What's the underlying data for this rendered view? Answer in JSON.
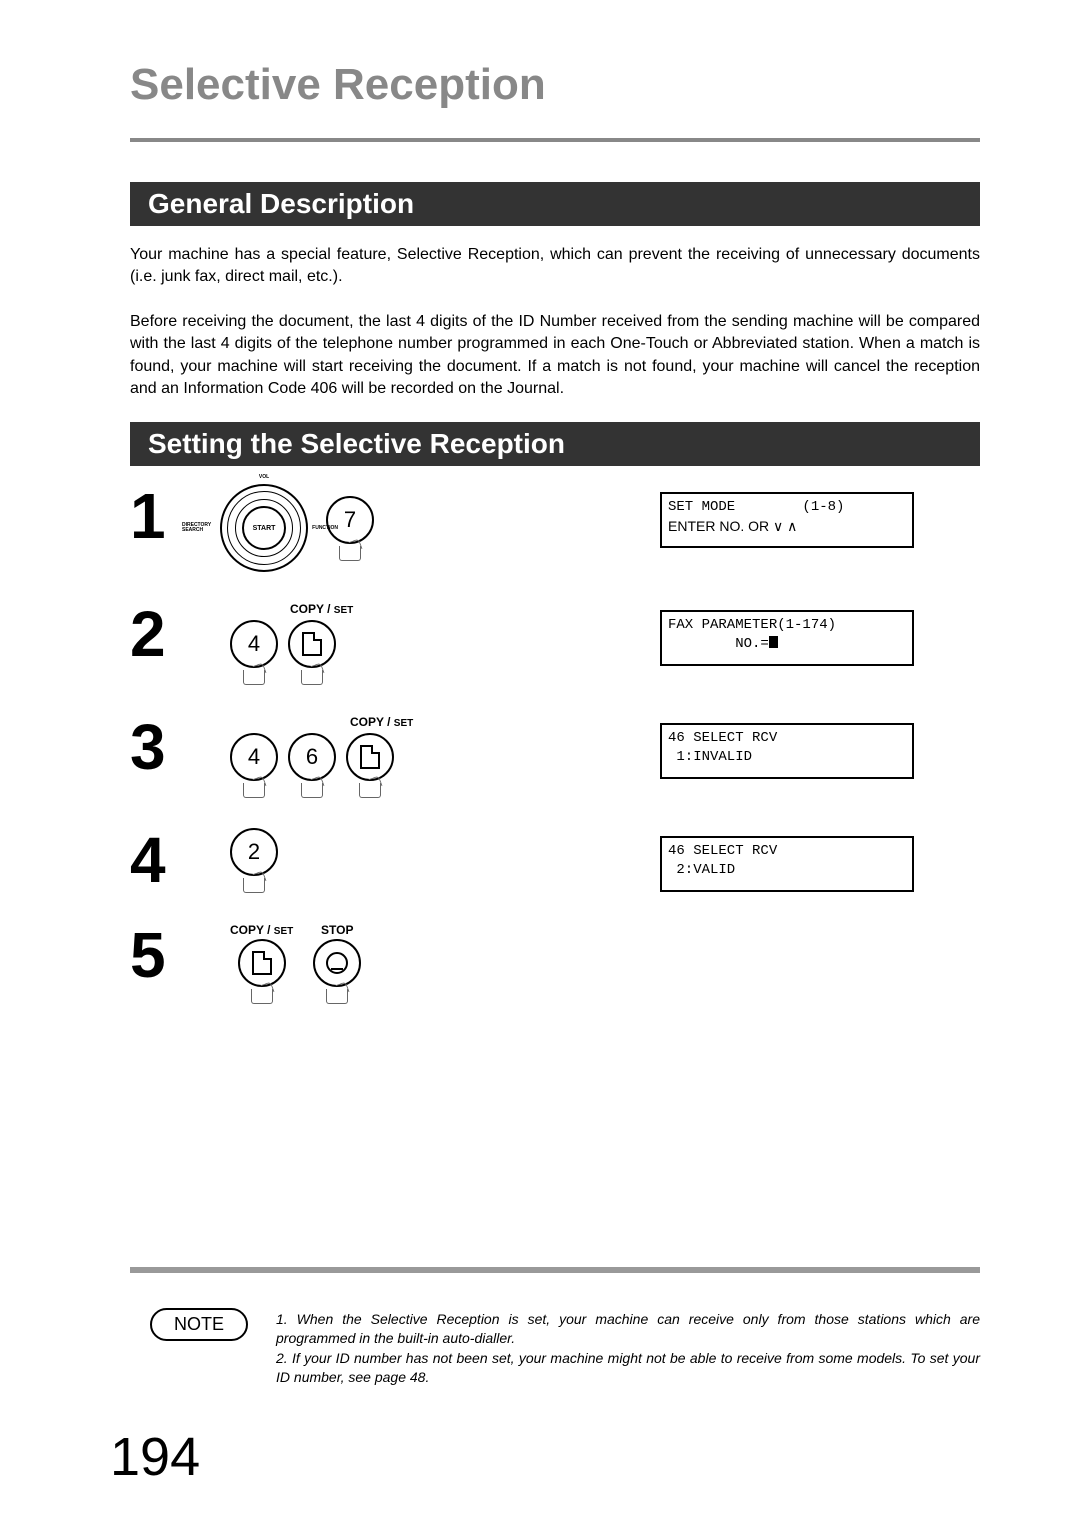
{
  "title": "Selective Reception",
  "section1": {
    "heading": "General Description",
    "para1": "Your machine has a special feature, Selective Reception, which can prevent the receiving of unnecessary documents (i.e. junk fax, direct mail, etc.).",
    "para2": "Before receiving the document, the last 4 digits of the ID Number received from the sending machine will be compared with the last 4 digits of the telephone number programmed in each One-Touch or Abbreviated station. When a match is found, your machine will start receiving the document. If a match is not found, your machine will cancel the reception and an Information Code 406 will be recorded on the Journal."
  },
  "section2": {
    "heading": "Setting the Selective Reception"
  },
  "dial": {
    "start": "START",
    "vol": "VOL",
    "dirsearch": "DIRECTORY\nSEARCH",
    "function": "FUNCTION"
  },
  "labels": {
    "copyset_copy": "COPY / ",
    "copyset_set": "SET",
    "stop": "STOP"
  },
  "steps": {
    "s1": {
      "num": "1",
      "key": "7",
      "lcd_line1": "SET MODE        (1-8)",
      "lcd_line2": "ENTER NO. OR ∨ ∧"
    },
    "s2": {
      "num": "2",
      "key1": "4",
      "lcd_line1": "FAX PARAMETER(1-174)",
      "lcd_line2": "        NO.="
    },
    "s3": {
      "num": "3",
      "key1": "4",
      "key2": "6",
      "lcd_line1": "46 SELECT RCV",
      "lcd_line2": " 1:INVALID"
    },
    "s4": {
      "num": "4",
      "key1": "2",
      "lcd_line1": "46 SELECT RCV",
      "lcd_line2": " 2:VALID"
    },
    "s5": {
      "num": "5"
    }
  },
  "note": {
    "label": "NOTE",
    "item1": "1. When the Selective Reception is set, your machine can receive only from those stations which are programmed in the built-in auto-dialler.",
    "item2": "2. If your ID number has not been set, your machine might not be able to receive from some models.  To set your ID number, see page 48."
  },
  "page_number": "194"
}
